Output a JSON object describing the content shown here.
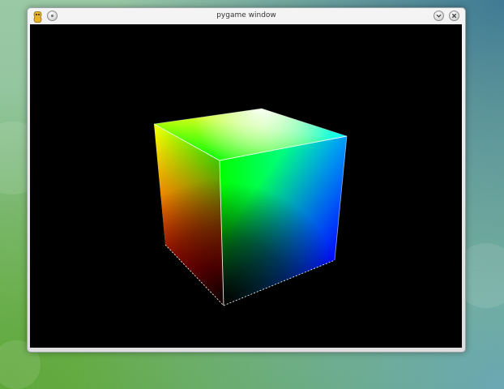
{
  "window": {
    "title": "pygame window",
    "app_icon": "pygame-snake-icon",
    "buttons": [
      {
        "name": "menu-button",
        "icon": "circle-icon"
      },
      {
        "name": "minimize-button",
        "icon": "chevron-down-icon"
      },
      {
        "name": "close-button",
        "icon": "close-icon"
      }
    ]
  },
  "scene": {
    "background_color": "#000000",
    "object": "rgb-color-cube",
    "edge_color": "#ffffff"
  },
  "colors": {
    "red": "#ff0000",
    "green": "#00ff00",
    "blue": "#0000ff",
    "yellow": "#ffff00",
    "cyan": "#00ffff",
    "white": "#ffffff",
    "black": "#000000"
  }
}
